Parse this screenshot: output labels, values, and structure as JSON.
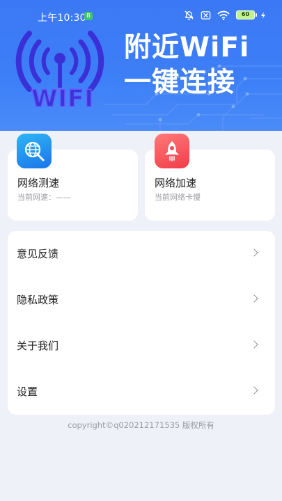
{
  "status_bar": {
    "time": "上午10:30",
    "chip": "B",
    "battery": "60"
  },
  "banner": {
    "logo_text": "WIFI",
    "title_line1": "附近WiFi",
    "title_line2": "一键连接"
  },
  "cards": [
    {
      "title": "网络测速",
      "subtitle": "当前网速：——",
      "icon": "globe-search-icon"
    },
    {
      "title": "网络加速",
      "subtitle": "当前网络卡慢",
      "icon": "rocket-icon"
    }
  ],
  "menu": {
    "items": [
      {
        "label": "意见反馈"
      },
      {
        "label": "隐私政策"
      },
      {
        "label": "关于我们"
      },
      {
        "label": "设置"
      }
    ]
  },
  "footer": {
    "copyright": "copyright©q020212171535 版权所有"
  },
  "colors": {
    "banner": "#3b78f5",
    "background": "#eef1f8",
    "speed_icon": "#1a74ea",
    "accel_icon": "#f03d4a"
  }
}
